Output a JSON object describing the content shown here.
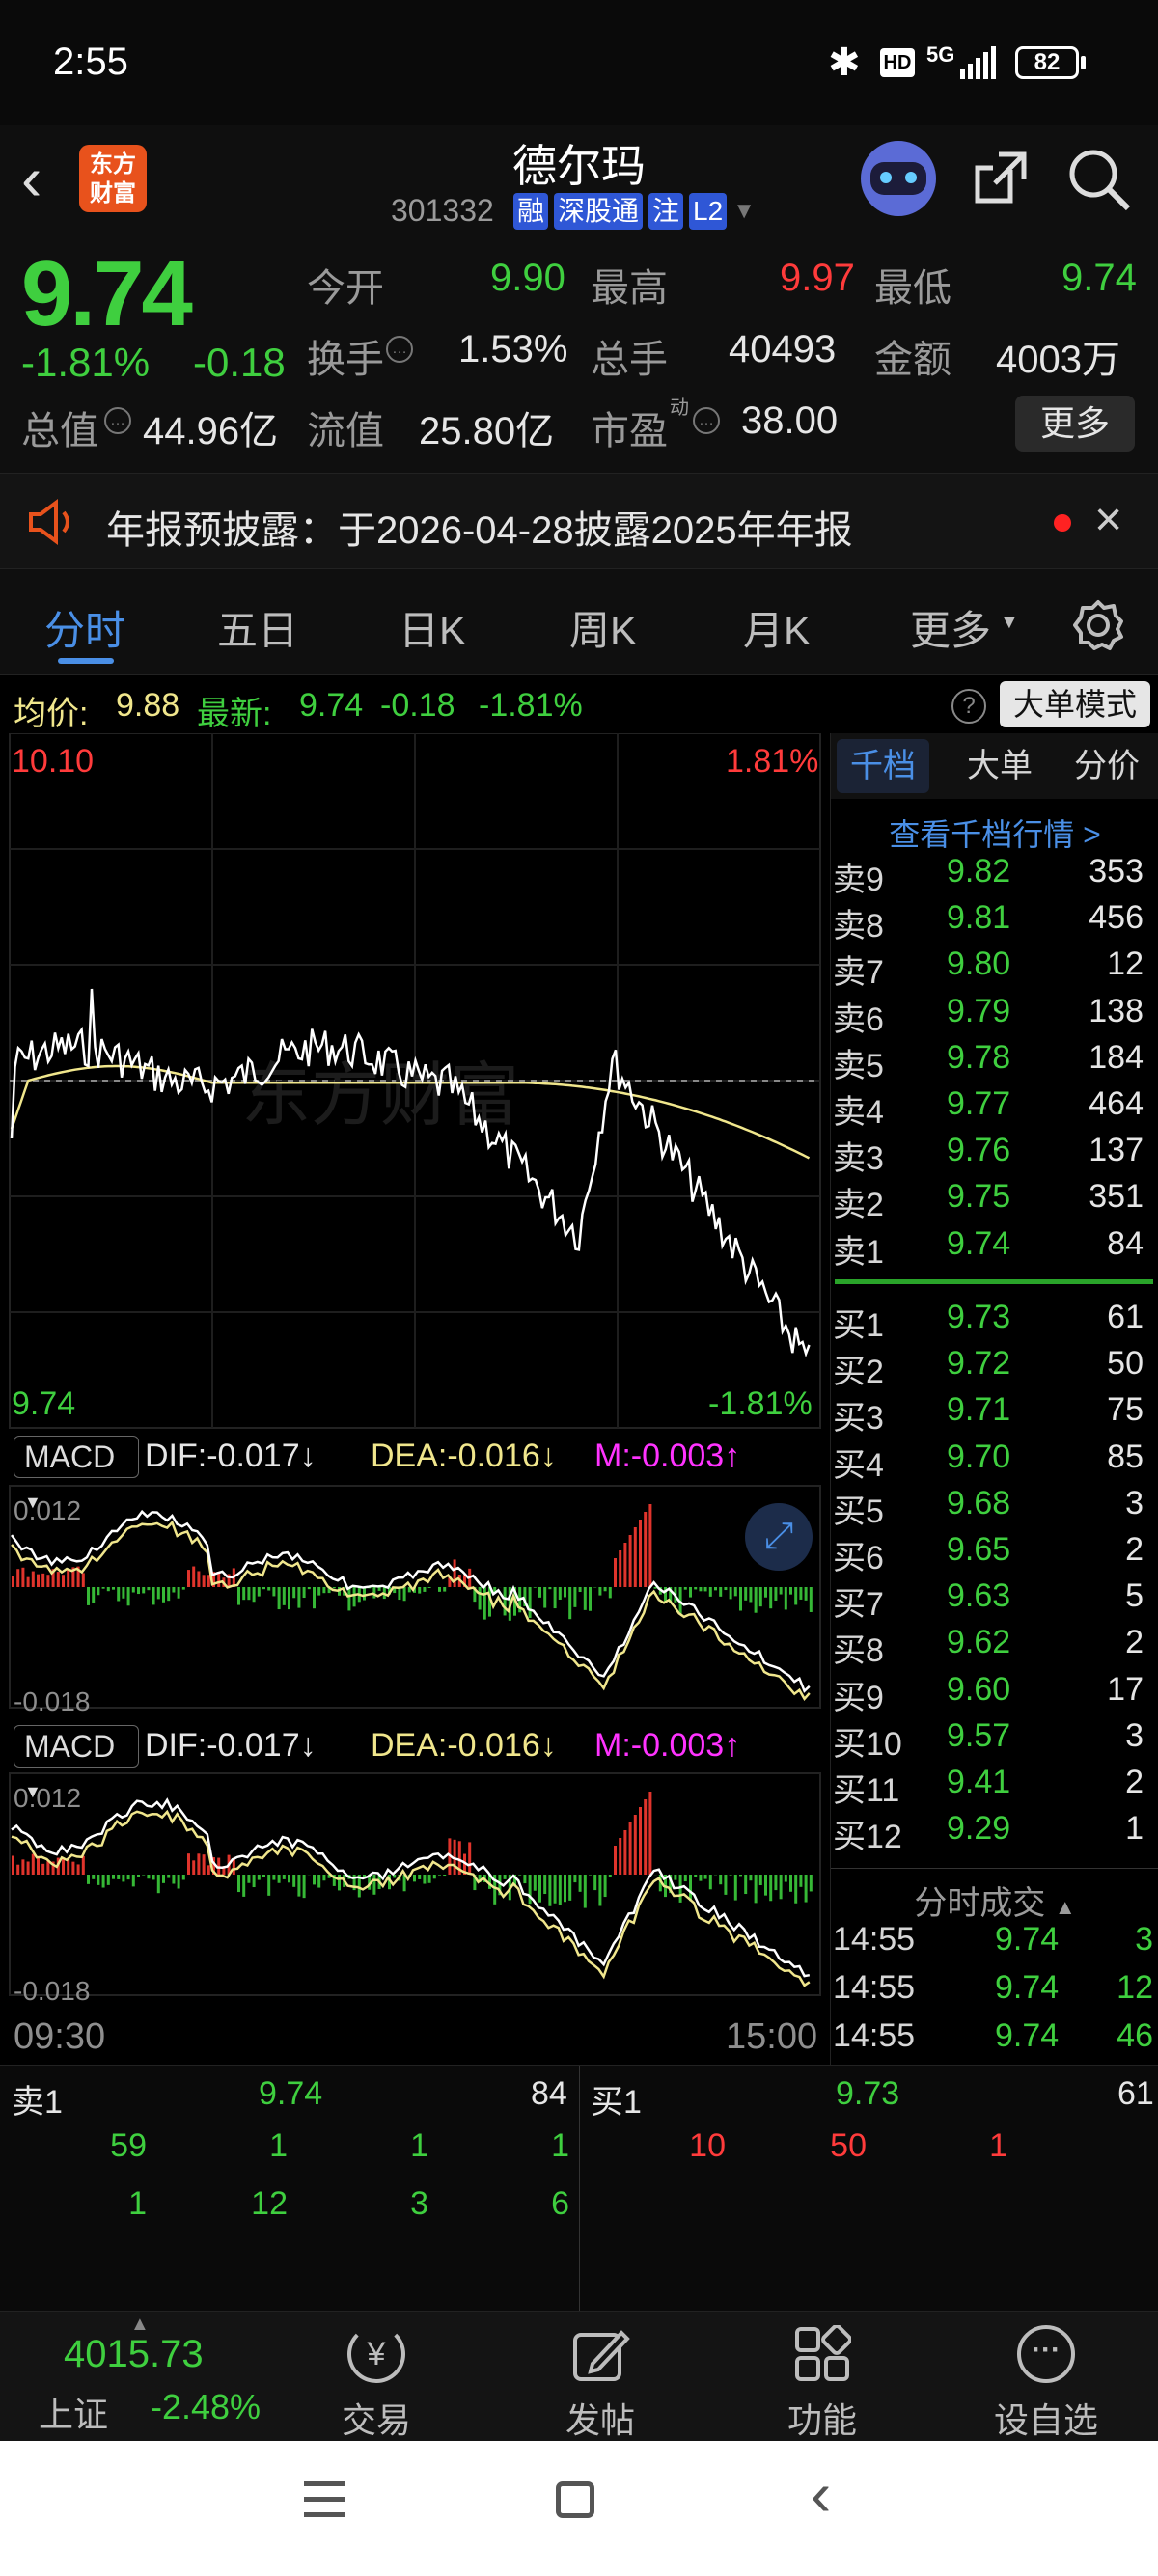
{
  "status": {
    "time": "2:55",
    "battery": "82",
    "network": "5G",
    "hd": "HD"
  },
  "header": {
    "logo_text": "东方\n财富",
    "name": "德尔玛",
    "code": "301332",
    "tags": [
      "融",
      "深股通",
      "注",
      "L2"
    ]
  },
  "quote": {
    "price": "9.74",
    "pct": "-1.81%",
    "chg": "-0.18",
    "open_label": "今开",
    "open": "9.90",
    "high_label": "最高",
    "high": "9.97",
    "low_label": "最低",
    "low": "9.74",
    "turnover_label": "换手",
    "turnover": "1.53%",
    "volume_label": "总手",
    "volume": "40493",
    "amount_label": "金额",
    "amount": "4003万",
    "mcap_label": "总值",
    "mcap": "44.96亿",
    "float_label": "流值",
    "float": "25.80亿",
    "pe_label": "市盈",
    "pe_sup": "动",
    "pe": "38.00",
    "more_button": "更多"
  },
  "notice": {
    "text": "年报预披露：于2026-04-28披露2025年年报"
  },
  "tabs": [
    "分时",
    "五日",
    "日K",
    "周K",
    "月K",
    "更多"
  ],
  "info_bar": {
    "avg_label": "均价:",
    "avg": "9.88",
    "last_label": "最新:",
    "last": "9.74",
    "chg": "-0.18",
    "pct": "-1.81%",
    "mode_button": "大单模式"
  },
  "chart": {
    "top_price": "10.10",
    "top_pct": "1.81%",
    "bottom_price": "9.74",
    "bottom_pct": "-1.81%",
    "watermark": "东方财富",
    "time_start": "09:30",
    "time_end": "15:00"
  },
  "macd1": {
    "label": "MACD",
    "dif": "DIF:-0.017",
    "dea": "DEA:-0.016",
    "m": "M:-0.003",
    "top": "0.012",
    "bottom": "-0.018"
  },
  "macd2": {
    "label": "MACD",
    "dif": "DIF:-0.017",
    "dea": "DEA:-0.016",
    "m": "M:-0.003",
    "top": "0.012",
    "bottom": "-0.018"
  },
  "side": {
    "tabs": [
      "千档",
      "大单",
      "分价"
    ],
    "link": "查看千档行情 >",
    "asks": [
      {
        "label": "卖9",
        "price": "9.82",
        "vol": "353"
      },
      {
        "label": "卖8",
        "price": "9.81",
        "vol": "456"
      },
      {
        "label": "卖7",
        "price": "9.80",
        "vol": "12"
      },
      {
        "label": "卖6",
        "price": "9.79",
        "vol": "138"
      },
      {
        "label": "卖5",
        "price": "9.78",
        "vol": "184"
      },
      {
        "label": "卖4",
        "price": "9.77",
        "vol": "464"
      },
      {
        "label": "卖3",
        "price": "9.76",
        "vol": "137"
      },
      {
        "label": "卖2",
        "price": "9.75",
        "vol": "351"
      },
      {
        "label": "卖1",
        "price": "9.74",
        "vol": "84"
      }
    ],
    "bids": [
      {
        "label": "买1",
        "price": "9.73",
        "vol": "61"
      },
      {
        "label": "买2",
        "price": "9.72",
        "vol": "50"
      },
      {
        "label": "买3",
        "price": "9.71",
        "vol": "75"
      },
      {
        "label": "买4",
        "price": "9.70",
        "vol": "85"
      },
      {
        "label": "买5",
        "price": "9.68",
        "vol": "3"
      },
      {
        "label": "买6",
        "price": "9.65",
        "vol": "2"
      },
      {
        "label": "买7",
        "price": "9.63",
        "vol": "5"
      },
      {
        "label": "买8",
        "price": "9.62",
        "vol": "2"
      },
      {
        "label": "买9",
        "price": "9.60",
        "vol": "17"
      },
      {
        "label": "买10",
        "price": "9.57",
        "vol": "3"
      },
      {
        "label": "买11",
        "price": "9.41",
        "vol": "2"
      },
      {
        "label": "买12",
        "price": "9.29",
        "vol": "1"
      }
    ],
    "trades_title": "分时成交",
    "trades": [
      {
        "time": "14:55",
        "price": "9.74",
        "vol": "3"
      },
      {
        "time": "14:55",
        "price": "9.74",
        "vol": "12"
      },
      {
        "time": "14:55",
        "price": "9.74",
        "vol": "46"
      }
    ]
  },
  "bottom_quote": {
    "sell_label": "卖1",
    "sell_price": "9.74",
    "sell_vol": "84",
    "buy_label": "买1",
    "buy_price": "9.73",
    "buy_vol": "61",
    "sell_row1": [
      "59",
      "1",
      "1",
      "1"
    ],
    "sell_row2": [
      "1",
      "12",
      "3",
      "6"
    ],
    "buy_row1": [
      "10",
      "50",
      "1"
    ]
  },
  "bottom_nav": {
    "index_value": "4015.73",
    "index_name": "上证",
    "index_pct": "-2.48%",
    "items": [
      "交易",
      "发帖",
      "功能",
      "设自选"
    ]
  }
}
